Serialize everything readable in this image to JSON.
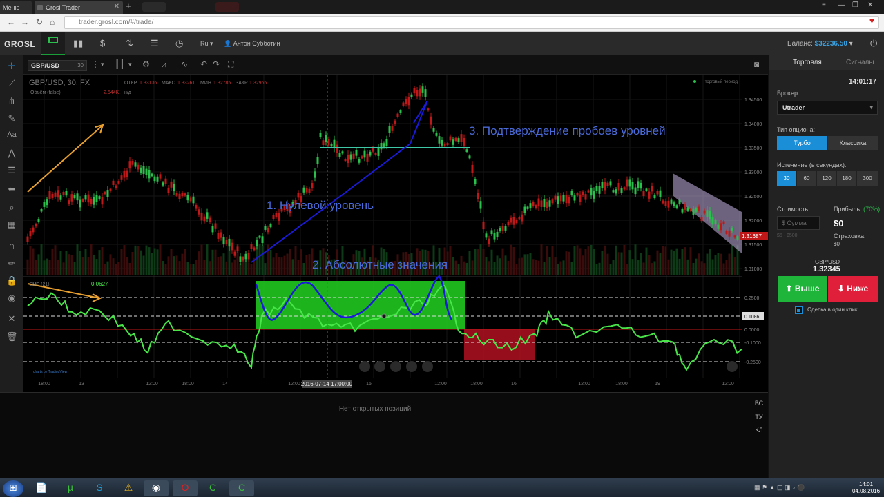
{
  "browser": {
    "menu_tab": "Меню",
    "active_tab": "Grosl Trader",
    "url": "trader.grosl.com/#/trade/"
  },
  "app": {
    "logo": "GROSL",
    "lang": "Ru",
    "user": "Антон Субботин",
    "balance_label": "Баланс:",
    "balance_value": "$32236.50"
  },
  "chart_toolbar": {
    "symbol": "GBP/USD",
    "interval": "30"
  },
  "chart": {
    "legend_symbol": "GBP/USD, 30, FX",
    "open_label": "ОТКР",
    "open": "1.33136",
    "high_label": "МАКС",
    "high": "1.33261",
    "low_label": "МИН",
    "low": "1.32785",
    "close_label": "ЗАКР",
    "close": "1.32965",
    "volume_label": "Объём (false)",
    "volume_value": "2.644K",
    "volume_na": "н/д",
    "session": "торговый период",
    "indicator_label": "CMF (21)",
    "indicator_value": "0.0627",
    "attribution": "charts by TradingView",
    "crosshair_time": "2016-07-14 17:00:00",
    "price_axis": [
      "1.34500",
      "1.34000",
      "1.33500",
      "1.33000",
      "1.32500",
      "1.32000",
      "1.31500",
      "1.31000"
    ],
    "current_price": "1.31687",
    "indicator_axis": [
      "0.2500",
      "0.1086",
      "0.0000",
      "-0.1000",
      "-0.2500"
    ],
    "time_axis": [
      "18:00",
      "13",
      "12:00",
      "18:00",
      "14",
      "12:00",
      "15",
      "12:00",
      "18:00",
      "16",
      "12:00",
      "18:00",
      "19",
      "12:00"
    ],
    "annotations": {
      "a1": "1. Нулевой уровень",
      "a2": "2. Абсолютные значения",
      "a3": "3. Подтверждение пробоев уровней"
    },
    "colors": {
      "price_line": "#1aa5d8",
      "cmf_line": "#49e64a",
      "annotation_text": "#4a6ad8",
      "abs_zone": "#1fc61f",
      "neg_zone": "#b01020",
      "channel": "#c8b4e6"
    }
  },
  "positions": {
    "empty": "Нет открытых позиций",
    "tabs": [
      "ВС",
      "ТУ",
      "КЛ"
    ]
  },
  "panel": {
    "tab_trade": "Торговля",
    "tab_signals": "Сигналы",
    "time": "14:01:17",
    "broker_label": "Брокер:",
    "broker_value": "Utrader",
    "option_type_label": "Тип опциона:",
    "turbo": "Турбо",
    "classic": "Классика",
    "expiry_label": "Истечение (в секундах):",
    "expiry_options": [
      "30",
      "60",
      "120",
      "180",
      "300"
    ],
    "cost_label": "Стоимость:",
    "amount_placeholder": "$ Сумма",
    "amount_range": "$5 - $500",
    "profit_label": "Прибыль:",
    "profit_pct": "(70%)",
    "profit_value": "$0",
    "insurance_label": "Страховка:",
    "insurance_value": "$0",
    "pair": "GBP/USD",
    "price": "1.32345",
    "up": "Выше",
    "down": "Ниже",
    "one_click": "Сделка в один клик"
  },
  "taskbar": {
    "time": "14:01",
    "date": "04.08.2016"
  }
}
